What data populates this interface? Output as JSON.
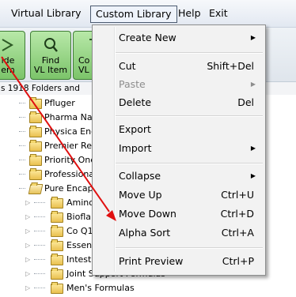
{
  "menubar": {
    "items": [
      "Virtual Library",
      "Custom Library",
      "Help",
      "Exit"
    ]
  },
  "toolbar": {
    "buttons": [
      {
        "label": "ide\nem",
        "icon": "hide-item-icon"
      },
      {
        "label": "Find\nVL Item",
        "icon": "search-icon"
      },
      {
        "label": "Co\nVL",
        "icon": "collapse-icon"
      }
    ]
  },
  "status": {
    "text": "s 1918 Folders and"
  },
  "tree": {
    "items": [
      {
        "label": "Pfluger"
      },
      {
        "label": "Pharma Natu"
      },
      {
        "label": "Physica Ene"
      },
      {
        "label": "Premier Res"
      },
      {
        "label": "Priority One"
      },
      {
        "label": "Professiona"
      },
      {
        "label": "Pure Encaps"
      },
      {
        "label": "Amino"
      },
      {
        "label": "Biofla"
      },
      {
        "label": "Co Q1"
      },
      {
        "label": "Essen"
      },
      {
        "label": "Intest"
      },
      {
        "label": "Joint Support Formulas"
      },
      {
        "label": "Men's Formulas"
      }
    ]
  },
  "menu": {
    "items": [
      {
        "label": "Create New",
        "shortcut": "",
        "submenu": true,
        "disabled": false
      },
      {
        "label": "Cut",
        "shortcut": "Shift+Del",
        "submenu": false,
        "disabled": false
      },
      {
        "label": "Paste",
        "shortcut": "",
        "submenu": true,
        "disabled": true
      },
      {
        "label": "Delete",
        "shortcut": "Del",
        "submenu": false,
        "disabled": false
      },
      {
        "label": "Export",
        "shortcut": "",
        "submenu": false,
        "disabled": false
      },
      {
        "label": "Import",
        "shortcut": "",
        "submenu": true,
        "disabled": false
      },
      {
        "label": "Collapse",
        "shortcut": "",
        "submenu": true,
        "disabled": false
      },
      {
        "label": "Move Up",
        "shortcut": "Ctrl+U",
        "submenu": false,
        "disabled": false
      },
      {
        "label": "Move Down",
        "shortcut": "Ctrl+D",
        "submenu": false,
        "disabled": false
      },
      {
        "label": "Alpha Sort",
        "shortcut": "Ctrl+A",
        "submenu": false,
        "disabled": false
      },
      {
        "label": "Print Preview",
        "shortcut": "Ctrl+P",
        "submenu": false,
        "disabled": false
      }
    ],
    "submenu_glyph": "▶"
  },
  "annotation": {
    "arrow_color": "#e01010"
  },
  "colors": {
    "toolbar_button": "#8fd07c",
    "menu_bg": "#f2f2f2"
  }
}
